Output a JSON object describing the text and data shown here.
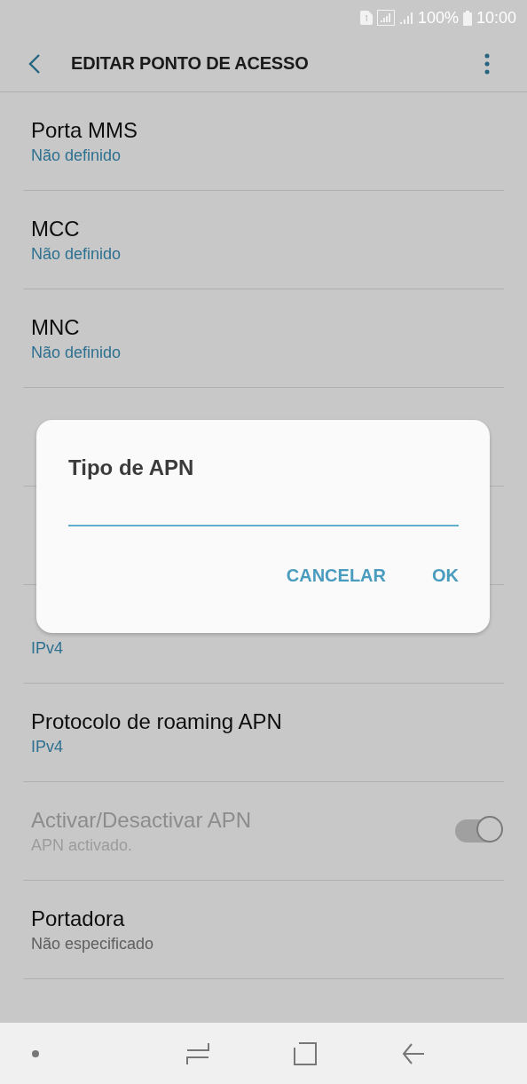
{
  "status_bar": {
    "battery": "100%",
    "time": "10:00"
  },
  "app_bar": {
    "title": "EDITAR PONTO DE ACESSO"
  },
  "settings": [
    {
      "kind": "value",
      "title": "Porta MMS",
      "value": "Não definido",
      "accent": true
    },
    {
      "kind": "value",
      "title": "MCC",
      "value": "Não definido",
      "accent": true
    },
    {
      "kind": "value",
      "title": "MNC",
      "value": "Não definido",
      "accent": true
    },
    {
      "kind": "covered"
    },
    {
      "kind": "covered"
    },
    {
      "kind": "value",
      "value": "IPv4",
      "accent": true
    },
    {
      "kind": "value",
      "title": "Protocolo de roaming APN",
      "value": "IPv4",
      "accent": true
    },
    {
      "kind": "toggle",
      "title": "Activar/Desactivar APN",
      "value": "APN activado.",
      "accent": false,
      "disabled": true,
      "on": true
    },
    {
      "kind": "value",
      "title": "Portadora",
      "value": "Não especificado",
      "accent": false
    }
  ],
  "dialog": {
    "title": "Tipo de APN",
    "buttons": [
      "CANCELAR",
      "OK"
    ]
  }
}
